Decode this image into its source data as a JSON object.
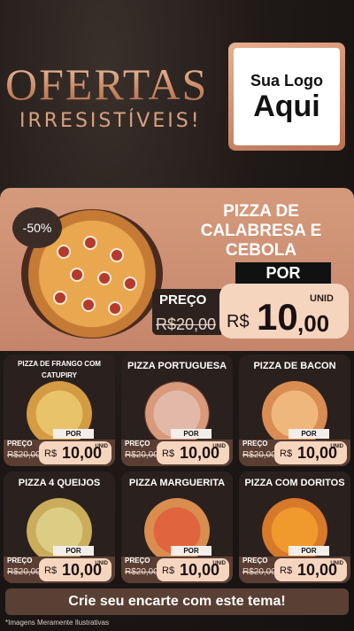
{
  "header": {
    "title": "OFERTAS",
    "subtitle": "IRRESISTÍVEIS!",
    "logo_line1": "Sua Logo",
    "logo_line2": "Aqui"
  },
  "featured": {
    "discount": "-50%",
    "name": "PIZZA DE CALABRESA E CEBOLA",
    "por": "POR",
    "preco_label": "PREÇO",
    "old_price": "R$20,00",
    "unid": "UNID",
    "currency": "R$",
    "price_main": "10",
    "price_cents": ",00"
  },
  "cards": [
    {
      "name": "PIZZA DE FRANGO COM CATUPIRY",
      "por": "POR",
      "preco": "PREÇO",
      "old": "R$20,00",
      "unid": "UNID",
      "rs": "R$",
      "value": "10,00"
    },
    {
      "name": "PIZZA PORTUGUESA",
      "por": "POR",
      "preco": "PREÇO",
      "old": "R$20,00",
      "unid": "UNID",
      "rs": "R$",
      "value": "10,00"
    },
    {
      "name": "PIZZA DE BACON",
      "por": "POR",
      "preco": "PREÇO",
      "old": "R$20,00",
      "unid": "UNID",
      "rs": "R$",
      "value": "10,00"
    },
    {
      "name": "PIZZA 4 QUEIJOS",
      "por": "POR",
      "preco": "PREÇO",
      "old": "R$20,00",
      "unid": "UNID",
      "rs": "R$",
      "value": "10,00"
    },
    {
      "name": "PIZZA MARGUERITA",
      "por": "POR",
      "preco": "PREÇO",
      "old": "R$20,00",
      "unid": "UNID",
      "rs": "R$",
      "value": "10,00"
    },
    {
      "name": "PIZZA COM DORITOS",
      "por": "POR",
      "preco": "PREÇO",
      "old": "R$20,00",
      "unid": "UNID",
      "rs": "R$",
      "value": "10,00"
    }
  ],
  "cta": "Crie seu encarte com este tema!",
  "footnote": "*Imagens Meramente Ilustrativas",
  "colors": {
    "accent": "#d59a7c",
    "card_bg": "#2a201d",
    "price_bg": "#f6d5bf"
  }
}
